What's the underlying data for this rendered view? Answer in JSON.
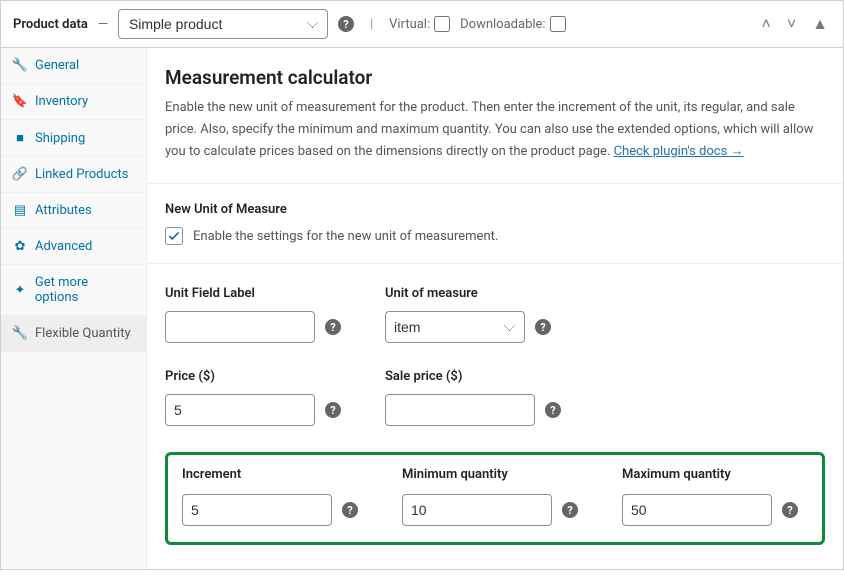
{
  "header": {
    "title": "Product data",
    "dash": "—",
    "product_type": "Simple product",
    "virtual_label": "Virtual:",
    "downloadable_label": "Downloadable:"
  },
  "sidebar": {
    "items": [
      {
        "label": "General",
        "icon": "wrench",
        "active": false
      },
      {
        "label": "Inventory",
        "icon": "tag",
        "active": false
      },
      {
        "label": "Shipping",
        "icon": "truck",
        "active": false
      },
      {
        "label": "Linked Products",
        "icon": "link",
        "active": false
      },
      {
        "label": "Attributes",
        "icon": "list",
        "active": false
      },
      {
        "label": "Advanced",
        "icon": "gear",
        "active": false
      },
      {
        "label": "Get more options",
        "icon": "bolt",
        "active": false
      },
      {
        "label": "Flexible Quantity",
        "icon": "wrench",
        "active": true
      }
    ]
  },
  "panel": {
    "title": "Measurement calculator",
    "intro": "Enable the new unit of measurement for the product. Then enter the increment of the unit, its regular, and sale price. Also, specify the minimum and maximum quantity. You can also use the extended options, which will allow you to calculate prices based on the dimensions directly on the product page. ",
    "docs_link": "Check plugin's docs →",
    "unit_section_title": "New Unit of Measure",
    "enable_label": "Enable the settings for the new unit of measurement.",
    "enable_checked": true
  },
  "fields": {
    "unit_field_label": {
      "label": "Unit Field Label",
      "value": ""
    },
    "unit_of_measure": {
      "label": "Unit of measure",
      "value": "item"
    },
    "price": {
      "label": "Price ($)",
      "value": "5"
    },
    "sale_price": {
      "label": "Sale price ($)",
      "value": ""
    },
    "increment": {
      "label": "Increment",
      "value": "5"
    },
    "min_qty": {
      "label": "Minimum quantity",
      "value": "10"
    },
    "max_qty": {
      "label": "Maximum quantity",
      "value": "50"
    }
  },
  "icons": {
    "wrench": "🔧",
    "tag": "🔖",
    "truck": "■",
    "link": "🔗",
    "list": "▤",
    "gear": "✿",
    "bolt": "✦"
  }
}
